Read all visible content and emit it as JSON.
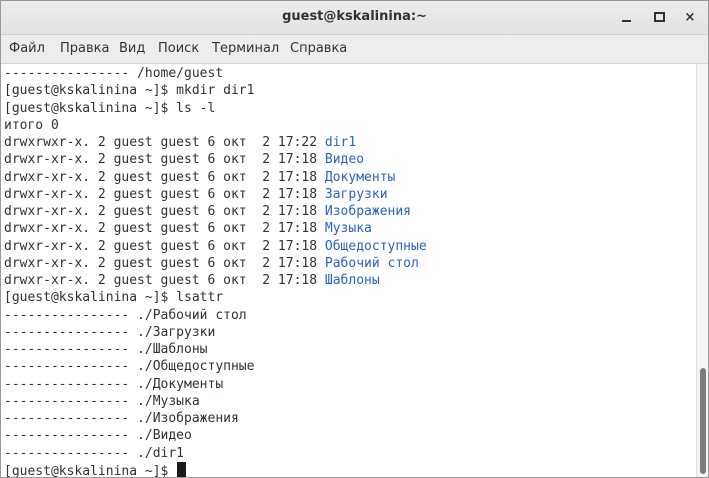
{
  "window": {
    "title": "guest@kskalinina:~",
    "minimize_label": "_",
    "close_label": "×"
  },
  "menu": {
    "items": [
      "Файл",
      "Правка",
      "Вид",
      "Поиск",
      "Терминал",
      "Справка"
    ]
  },
  "terminal": {
    "lines": [
      {
        "pre": "---------------- /home/guest",
        "link": ""
      },
      {
        "pre": "[guest@kskalinina ~]$ mkdir dir1",
        "link": ""
      },
      {
        "pre": "[guest@kskalinina ~]$ ls -l",
        "link": ""
      },
      {
        "pre": "итого 0",
        "link": ""
      },
      {
        "pre": "drwxrwxr-x. 2 guest guest 6 окт  2 17:22 ",
        "link": "dir1"
      },
      {
        "pre": "drwxr-xr-x. 2 guest guest 6 окт  2 17:18 ",
        "link": "Видео"
      },
      {
        "pre": "drwxr-xr-x. 2 guest guest 6 окт  2 17:18 ",
        "link": "Документы"
      },
      {
        "pre": "drwxr-xr-x. 2 guest guest 6 окт  2 17:18 ",
        "link": "Загрузки"
      },
      {
        "pre": "drwxr-xr-x. 2 guest guest 6 окт  2 17:18 ",
        "link": "Изображения"
      },
      {
        "pre": "drwxr-xr-x. 2 guest guest 6 окт  2 17:18 ",
        "link": "Музыка"
      },
      {
        "pre": "drwxr-xr-x. 2 guest guest 6 окт  2 17:18 ",
        "link": "Общедоступные"
      },
      {
        "pre": "drwxr-xr-x. 2 guest guest 6 окт  2 17:18 ",
        "link": "Рабочий стол"
      },
      {
        "pre": "drwxr-xr-x. 2 guest guest 6 окт  2 17:18 ",
        "link": "Шаблоны"
      },
      {
        "pre": "[guest@kskalinina ~]$ lsattr",
        "link": ""
      },
      {
        "pre": "---------------- ./Рабочий стол",
        "link": ""
      },
      {
        "pre": "---------------- ./Загрузки",
        "link": ""
      },
      {
        "pre": "---------------- ./Шаблоны",
        "link": ""
      },
      {
        "pre": "---------------- ./Общедоступные",
        "link": ""
      },
      {
        "pre": "---------------- ./Документы",
        "link": ""
      },
      {
        "pre": "---------------- ./Музыка",
        "link": ""
      },
      {
        "pre": "---------------- ./Изображения",
        "link": ""
      },
      {
        "pre": "---------------- ./Видео",
        "link": ""
      },
      {
        "pre": "---------------- ./dir1",
        "link": ""
      },
      {
        "pre": "[guest@kskalinina ~]$ ",
        "link": ""
      }
    ]
  },
  "colors": {
    "directory_link": "#2a62c9",
    "text": "#2e3436",
    "background": "#ffffff"
  },
  "icons": [
    "minimize-icon",
    "maximize-icon",
    "close-icon"
  ]
}
